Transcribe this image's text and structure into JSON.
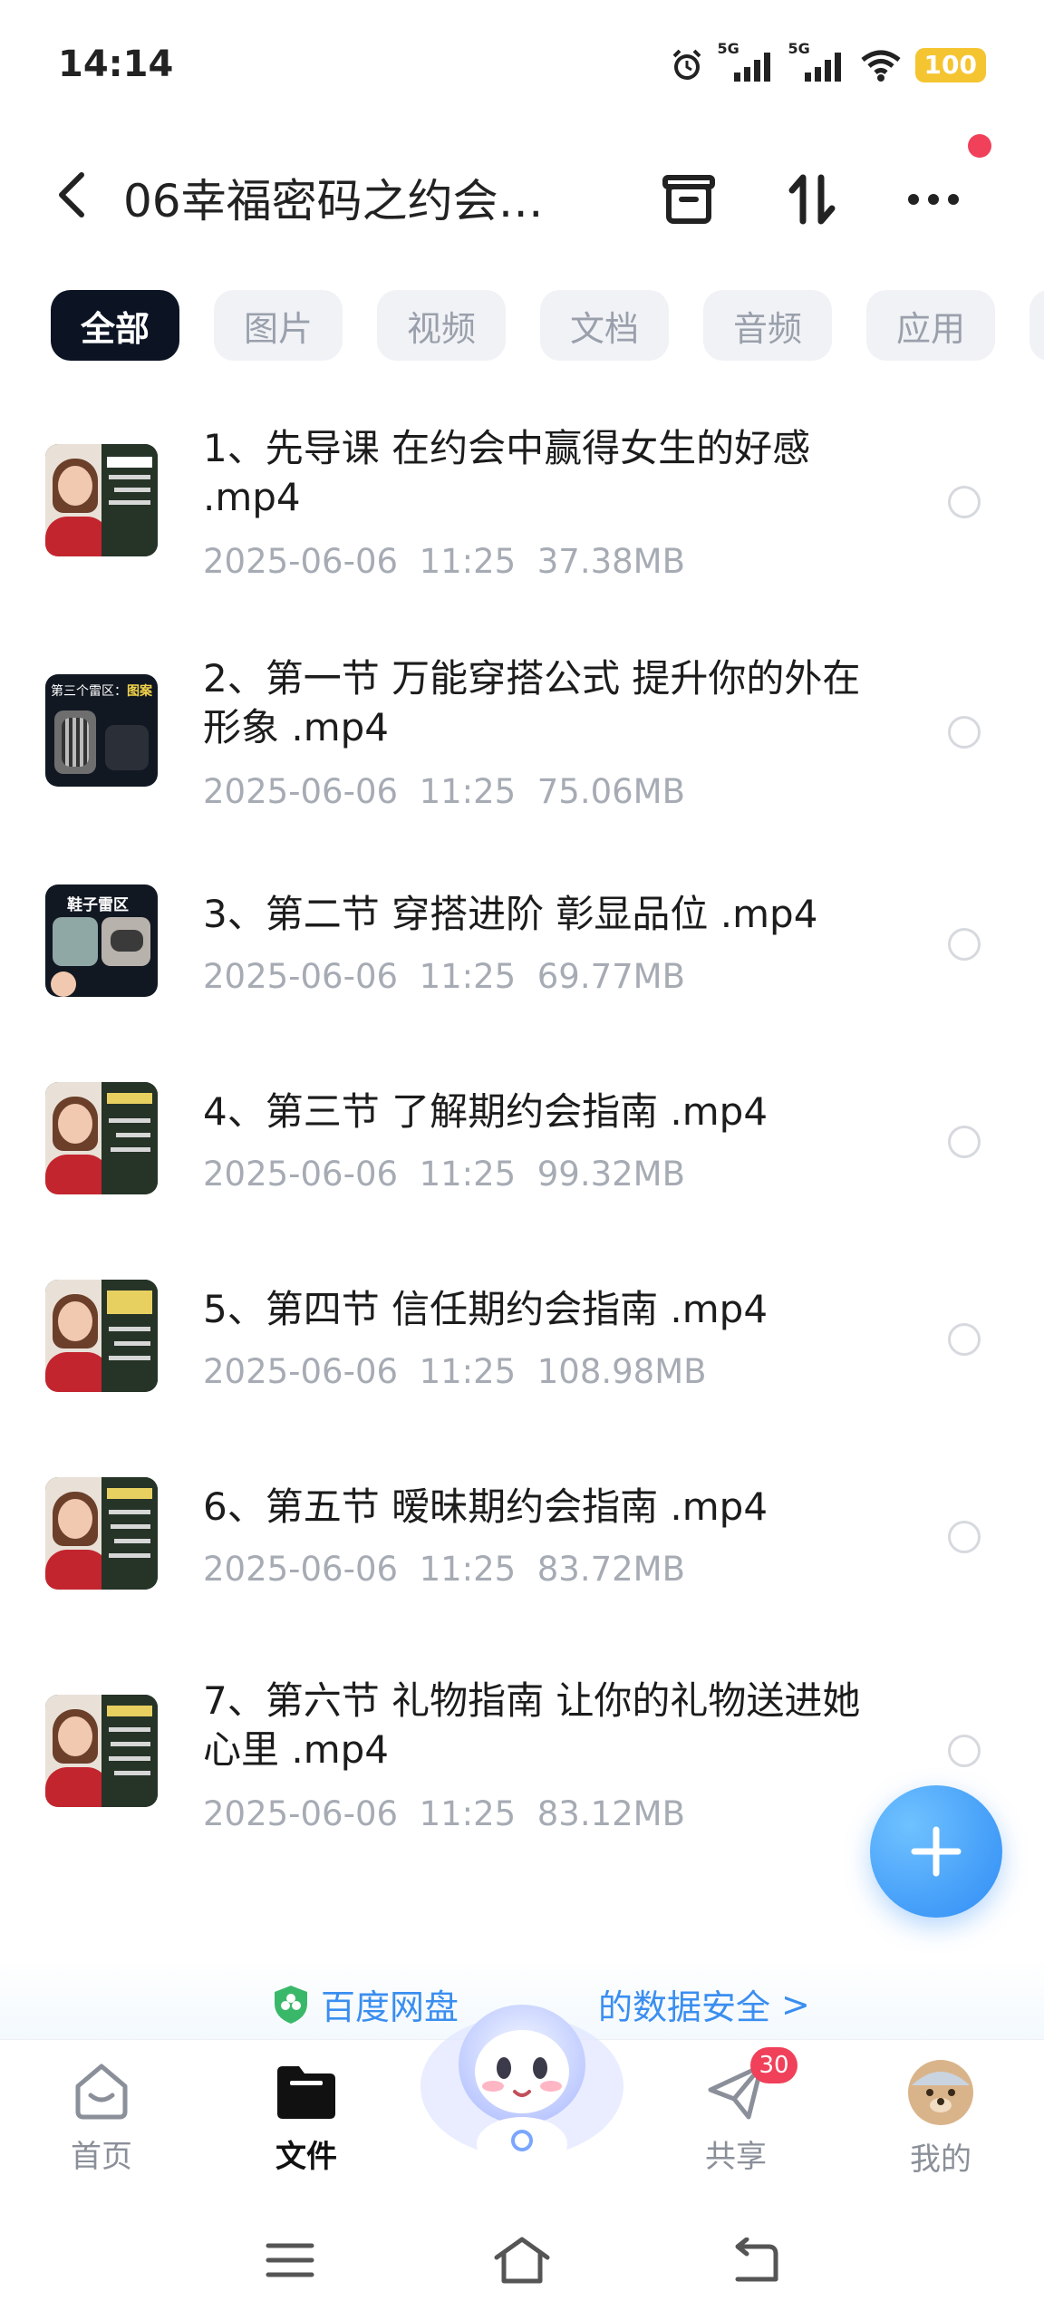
{
  "status_bar": {
    "time": "14:14",
    "signal1_label": "5G",
    "signal2_label": "5G",
    "battery": "100"
  },
  "header": {
    "title": "06幸福密码之约会…"
  },
  "tabs": [
    {
      "label": "全部",
      "active": true
    },
    {
      "label": "图片",
      "active": false
    },
    {
      "label": "视频",
      "active": false
    },
    {
      "label": "文档",
      "active": false
    },
    {
      "label": "音频",
      "active": false
    },
    {
      "label": "应用",
      "active": false
    }
  ],
  "files": [
    {
      "name": "1、先导课  在约会中赢得女生的好感 .mp4",
      "date": "2025-06-06",
      "time": "11:25",
      "size": "37.38MB"
    },
    {
      "name": "2、第一节  万能穿搭公式  提升你的外在形象 .mp4",
      "date": "2025-06-06",
      "time": "11:25",
      "size": "75.06MB",
      "thumb_text_prefix": "第三个雷区：",
      "thumb_text_highlight": "图案"
    },
    {
      "name": "3、第二节  穿搭进阶  彰显品位 .mp4",
      "date": "2025-06-06",
      "time": "11:25",
      "size": "69.77MB",
      "thumb_text": "鞋子雷区"
    },
    {
      "name": "4、第三节  了解期约会指南 .mp4",
      "date": "2025-06-06",
      "time": "11:25",
      "size": "99.32MB"
    },
    {
      "name": "5、第四节  信任期约会指南 .mp4",
      "date": "2025-06-06",
      "time": "11:25",
      "size": "108.98MB"
    },
    {
      "name": "6、第五节  暧昧期约会指南 .mp4",
      "date": "2025-06-06",
      "time": "11:25",
      "size": "83.72MB"
    },
    {
      "name": "7、第六节  礼物指南 让你的礼物送进她心里 .mp4",
      "date": "2025-06-06",
      "time": "11:25",
      "size": "83.12MB"
    }
  ],
  "promo": {
    "text_left": "百度网盘",
    "text_right": "的数据安全",
    "arrow": ">"
  },
  "bottom_nav": [
    {
      "label": "首页",
      "icon": "home-icon"
    },
    {
      "label": "文件",
      "icon": "folder-icon",
      "active": true
    },
    {
      "label": "共享",
      "icon": "share-icon",
      "badge": "30"
    },
    {
      "label": "我的",
      "icon": "avatar"
    }
  ]
}
